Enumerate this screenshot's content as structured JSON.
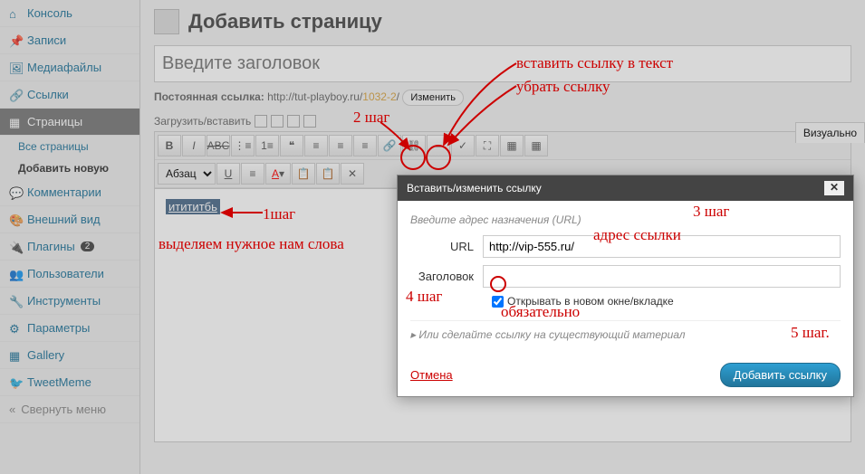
{
  "sidebar": {
    "items": [
      {
        "label": "Консоль",
        "icon": "dashboard-icon"
      },
      {
        "label": "Записи",
        "icon": "pin-icon"
      },
      {
        "label": "Медиафайлы",
        "icon": "media-icon"
      },
      {
        "label": "Ссылки",
        "icon": "link-icon"
      },
      {
        "label": "Страницы",
        "icon": "page-icon",
        "active": true
      },
      {
        "label": "Комментарии",
        "icon": "comment-icon"
      },
      {
        "label": "Внешний вид",
        "icon": "appearance-icon"
      },
      {
        "label": "Плагины",
        "icon": "plugin-icon",
        "badge": "2"
      },
      {
        "label": "Пользователи",
        "icon": "users-icon"
      },
      {
        "label": "Инструменты",
        "icon": "tools-icon"
      },
      {
        "label": "Параметры",
        "icon": "settings-icon"
      },
      {
        "label": "Gallery",
        "icon": "gallery-icon"
      },
      {
        "label": "TweetMeme",
        "icon": "tweet-icon"
      }
    ],
    "subitems": [
      {
        "label": "Все страницы"
      },
      {
        "label": "Добавить новую",
        "bold": true
      }
    ],
    "collapse": "Свернуть меню"
  },
  "page": {
    "title": "Добавить страницу",
    "title_placeholder": "Введите заголовок",
    "permalink_label": "Постоянная ссылка:",
    "permalink_url": "http://tut-playboy.ru/",
    "permalink_slug": "1032-2",
    "permalink_edit": "Изменить",
    "upload_label": "Загрузить/вставить",
    "tab_visual": "Визуально",
    "format_select": "Абзац",
    "selected_text": "итититбь"
  },
  "dialog": {
    "title": "Вставить/изменить ссылку",
    "hint": "Введите адрес назначения (URL)",
    "url_label": "URL",
    "url_value": "http://vip-555.ru/",
    "title_label": "Заголовок",
    "title_value": "",
    "newtab_label": "Открывать в новом окне/вкладке",
    "existing": "Или сделайте ссылку на существующий материал",
    "cancel": "Отмена",
    "submit": "Добавить ссылку"
  },
  "annotations": {
    "step1": "1шаг",
    "step1_text": "выделяем нужное нам слова",
    "step2": "2 шаг",
    "step2_text1": "вставить ссылку в текст",
    "step2_text2": "убрать ссылку",
    "step3": "3 шаг",
    "step3_text": "адрес ссылки",
    "step4": "4 шаг",
    "step4_text": "обязательно",
    "step5": "5 шаг."
  }
}
